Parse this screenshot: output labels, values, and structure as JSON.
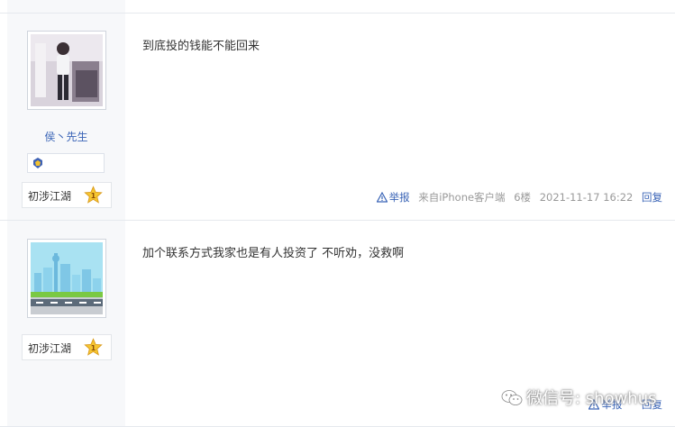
{
  "posts": [
    {
      "username": "侯丶先生",
      "level_label": "初涉江湖",
      "level_number": "1",
      "content": "到底投的钱能不能回来",
      "report_label": "举报",
      "source": "来自iPhone客户端",
      "floor": "6楼",
      "datetime": "2021-11-17 16:22",
      "reply_label": "回复"
    },
    {
      "level_label": "初涉江湖",
      "level_number": "1",
      "content": "加个联系方式我家也是有人投资了 不听劝，没救啊",
      "report_label": "举报",
      "source": "",
      "floor": "",
      "datetime": "",
      "reply_label": "回复"
    }
  ],
  "watermark": "微信号: showhus",
  "icons": [
    "warning-icon",
    "star-level-icon",
    "badge-icon",
    "wechat-icon"
  ],
  "colors": {
    "link": "#3a64b6",
    "meta": "#999999",
    "sidebar_bg": "#f7f8fa"
  }
}
